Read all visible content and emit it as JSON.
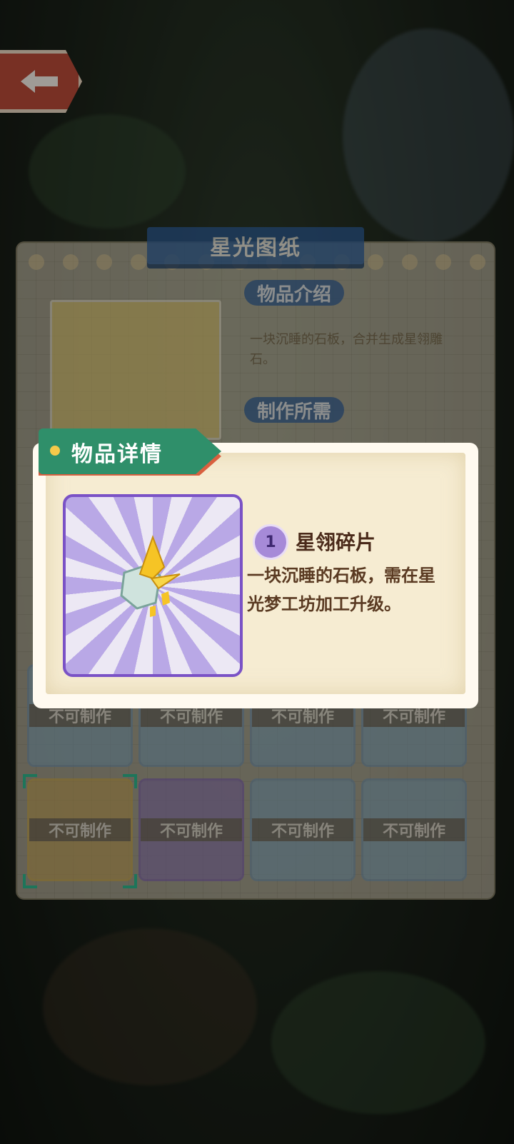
{
  "blueprint": {
    "title": "星光图纸",
    "intro_tag": "物品介绍",
    "intro_text": "一块沉睡的石板，合并生成星翎雕石。",
    "requirements_tag": "制作所需"
  },
  "grid": {
    "cards": [
      {
        "status": "不可制作",
        "style": "blue"
      },
      {
        "status": "不可制作",
        "style": "blue"
      },
      {
        "status": "不可制作",
        "style": "blue"
      },
      {
        "status": "不可制作",
        "style": "blue"
      },
      {
        "status": "不可制作",
        "style": "gold"
      },
      {
        "status": "不可制作",
        "style": "purple"
      },
      {
        "status": "不可制作",
        "style": "blue"
      },
      {
        "status": "不可制作",
        "style": "blue"
      }
    ]
  },
  "detail": {
    "header": "物品详情",
    "level": "1",
    "item_name": "星翎碎片",
    "description": "一块沉睡的石板，需在星光梦工坊加工升级。"
  },
  "colors": {
    "popup_ribbon": "#2f8f6a",
    "frame_border": "#7a52c6",
    "title_blue": "#2f5f9a"
  },
  "icons": {
    "back": "back-arrow-icon",
    "item": "crystal-shard-icon",
    "level": "level-badge-icon"
  }
}
